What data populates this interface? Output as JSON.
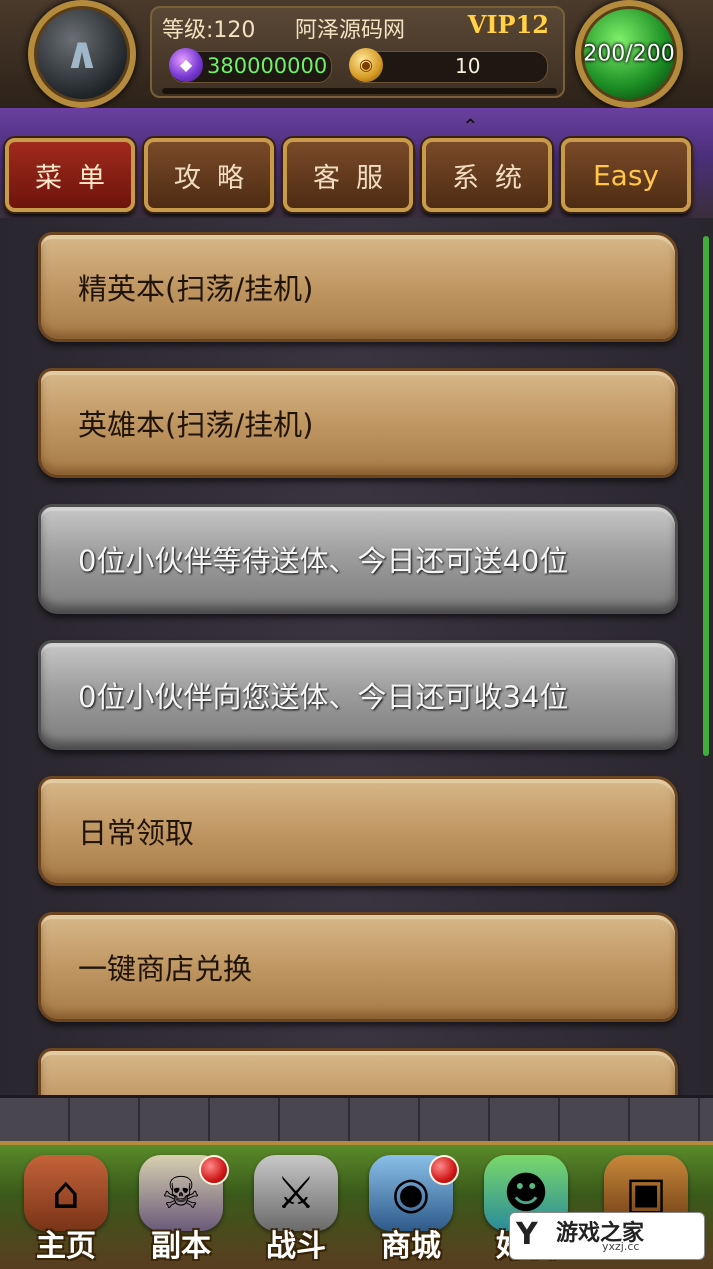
{
  "header": {
    "level_text": "等级:120",
    "site_name": "阿泽源码网",
    "vip_text": "VIP12",
    "gem_amount": "380000000",
    "coin_amount": "10",
    "hp_text": "200/200"
  },
  "tabs": [
    {
      "label": "菜单"
    },
    {
      "label": "攻略"
    },
    {
      "label": "客服"
    },
    {
      "label": "系统"
    },
    {
      "label": "Easy"
    }
  ],
  "menu_items": [
    {
      "label": "精英本(扫荡/挂机)",
      "style": "wood"
    },
    {
      "label": "英雄本(扫荡/挂机)",
      "style": "wood"
    },
    {
      "label": "0位小伙伴等待送体、今日还可送40位",
      "style": "stone"
    },
    {
      "label": "0位小伙伴向您送体、今日还可收34位",
      "style": "stone"
    },
    {
      "label": "日常领取",
      "style": "wood"
    },
    {
      "label": "一键商店兑换",
      "style": "wood"
    }
  ],
  "bottom_nav": [
    {
      "label": "主页",
      "icon": "house-icon"
    },
    {
      "label": "副本",
      "icon": "skull-icon"
    },
    {
      "label": "战斗",
      "icon": "sword-icon"
    },
    {
      "label": "商城",
      "icon": "monster-icon"
    },
    {
      "label": "好友",
      "icon": "friends-icon"
    }
  ],
  "watermark": {
    "title": "游戏之家",
    "subtitle": "yxzj.cc"
  },
  "colors": {
    "tab_active": "#a02a1c",
    "tab_easy_text": "#ffc64a",
    "gem_text": "#6ff06a",
    "hp_orb": "#2dbf35"
  }
}
